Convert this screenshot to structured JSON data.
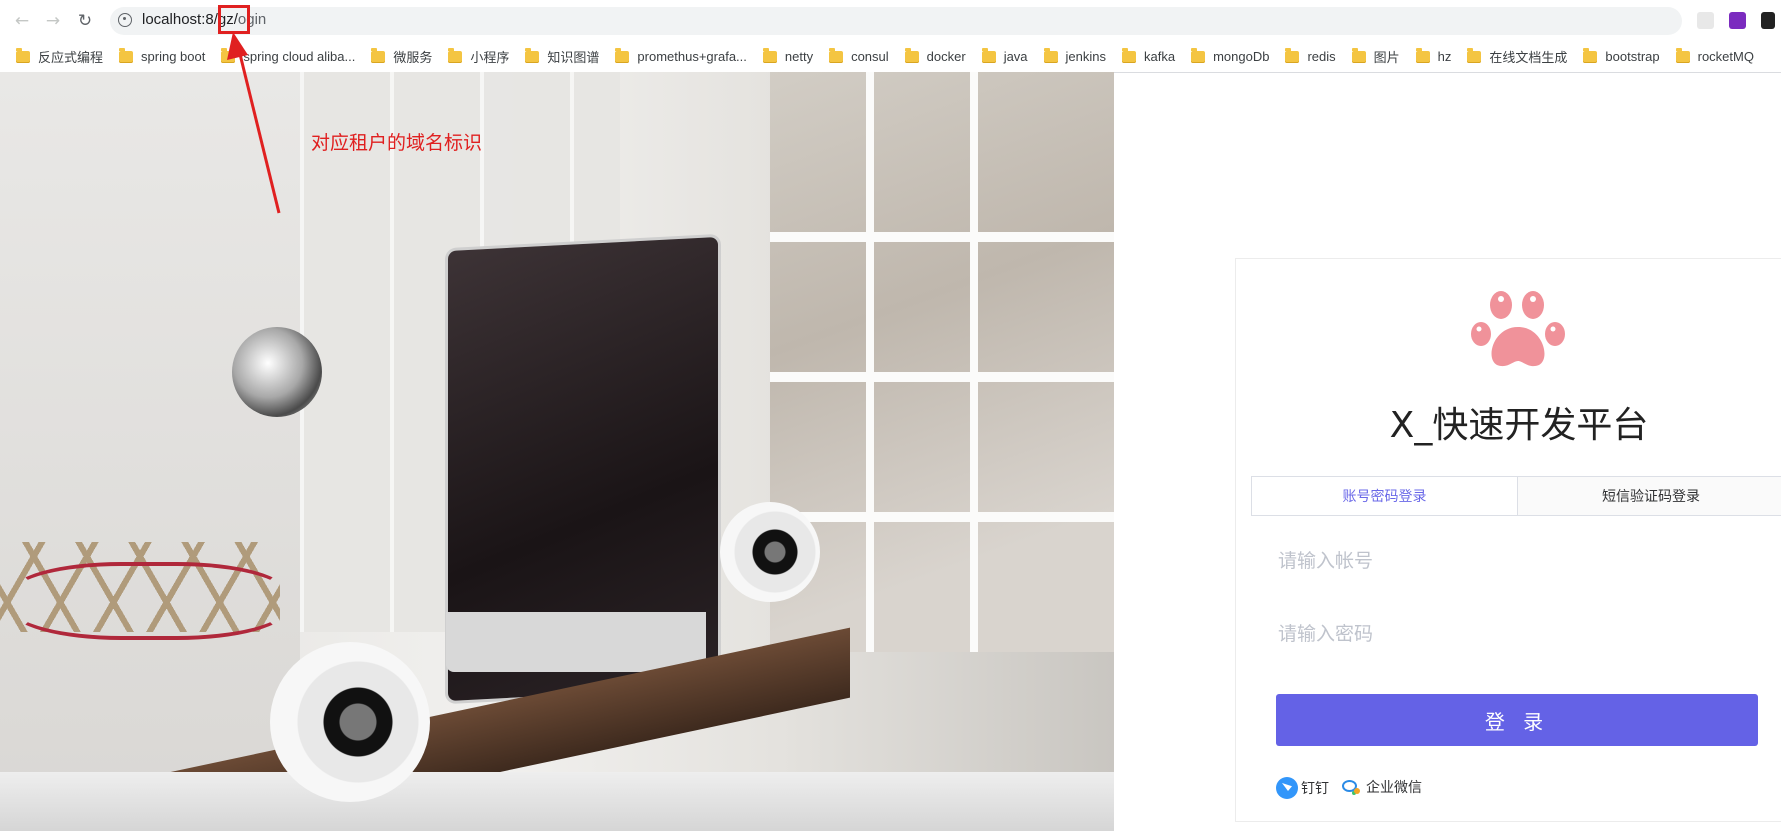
{
  "browser": {
    "url": {
      "host": "localhost:8",
      "tenant_path": "/gz/",
      "suffix": "ogin"
    },
    "bookmarks": [
      "反应式编程",
      "spring boot",
      "spring cloud aliba...",
      "微服务",
      "小程序",
      "知识图谱",
      "promethus+grafa...",
      "netty",
      "consul",
      "docker",
      "java",
      "jenkins",
      "kafka",
      "mongoDb",
      "redis",
      "图片",
      "hz",
      "在线文档生成",
      "bootstrap",
      "rocketMQ"
    ]
  },
  "annotation": {
    "text": "对应租户的域名标识",
    "color": "#e02020"
  },
  "login": {
    "title": "X_快速开发平台",
    "tabs": [
      {
        "label": "账号密码登录",
        "active": true
      },
      {
        "label": "短信验证码登录",
        "active": false
      }
    ],
    "account_placeholder": "请输入帐号",
    "password_placeholder": "请输入密码",
    "submit_label": "登 录",
    "sso": [
      {
        "label": "钉钉",
        "icon": "dingtalk-icon"
      },
      {
        "label": "企业微信",
        "icon": "wecom-icon"
      }
    ],
    "accent_color": "#6462e6",
    "logo_icon": "paw-icon",
    "logo_color": "#f0929a"
  }
}
